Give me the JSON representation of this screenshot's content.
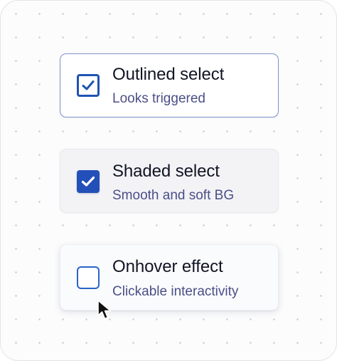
{
  "cards": [
    {
      "variant": "outlined",
      "title": "Outlined select",
      "subtitle": "Looks triggered",
      "checked": true
    },
    {
      "variant": "shaded",
      "title": "Shaded select",
      "subtitle": "Smooth and soft BG",
      "checked": true
    },
    {
      "variant": "hover",
      "title": "Onhover effect",
      "subtitle": "Clickable interactivity",
      "checked": false
    }
  ],
  "colors": {
    "accent": "#2350b8",
    "outline": "#7e93c8",
    "title_text": "#101524",
    "subtitle_text": "#4a4f86"
  },
  "icons": {
    "check": "check-icon",
    "cursor": "mouse-pointer-icon"
  }
}
